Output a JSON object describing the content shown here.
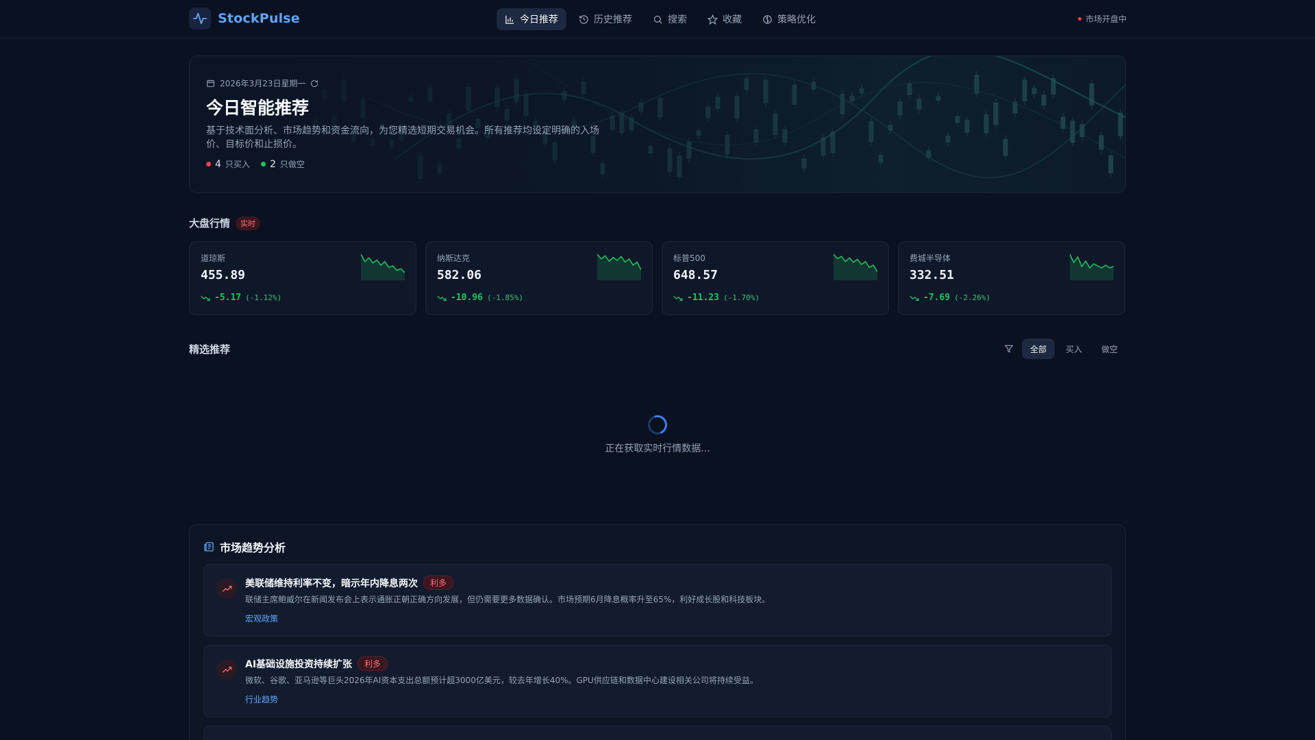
{
  "app": {
    "name": "StockPulse"
  },
  "nav": {
    "items": [
      {
        "label": "今日推荐",
        "icon": "bar-chart-icon",
        "active": true
      },
      {
        "label": "历史推荐",
        "icon": "history-icon",
        "active": false
      },
      {
        "label": "搜索",
        "icon": "search-icon",
        "active": false
      },
      {
        "label": "收藏",
        "icon": "star-icon",
        "active": false
      },
      {
        "label": "策略优化",
        "icon": "brain-icon",
        "active": false
      }
    ],
    "market_status": "市场开盘中"
  },
  "hero": {
    "date": "2026年3月23日星期一",
    "title": "今日智能推荐",
    "description": "基于技术面分析、市场趋势和资金流向，为您精选短期交易机会。所有推荐均设定明确的入场价、目标价和止损价。",
    "buy_count": "4",
    "buy_label": "只买入",
    "short_count": "2",
    "short_label": "只做空"
  },
  "indices": {
    "title": "大盘行情",
    "badge": "实时",
    "cards": [
      {
        "name": "道琼斯",
        "value": "455.89",
        "change": "-5.17",
        "pct": "(-1.12%)",
        "trend": [
          30,
          20,
          25,
          18,
          22,
          15,
          20,
          12,
          14,
          8,
          10,
          5
        ]
      },
      {
        "name": "纳斯达克",
        "value": "582.06",
        "change": "-10.96",
        "pct": "(-1.85%)",
        "trend": [
          28,
          22,
          26,
          19,
          24,
          20,
          25,
          18,
          22,
          14,
          18,
          8
        ]
      },
      {
        "name": "标普500",
        "value": "648.57",
        "change": "-11.23",
        "pct": "(-1.70%)",
        "trend": [
          30,
          24,
          27,
          20,
          25,
          19,
          23,
          16,
          20,
          12,
          15,
          6
        ]
      },
      {
        "name": "费城半导体",
        "value": "332.51",
        "change": "-7.69",
        "pct": "(-2.26%)",
        "trend": [
          32,
          20,
          28,
          14,
          22,
          12,
          18,
          15,
          12,
          16,
          12,
          14
        ]
      }
    ]
  },
  "picks": {
    "title": "精选推荐",
    "filters": [
      "全部",
      "买入",
      "做空"
    ],
    "active_filter": "全部",
    "loading_text": "正在获取实时行情数据..."
  },
  "analysis": {
    "title": "市场趋势分析",
    "items": [
      {
        "title": "美联储维持利率不变，暗示年内降息两次",
        "tag": "利多",
        "body": "联储主席鲍威尔在新闻发布会上表示通胀正朝正确方向发展，但仍需要更多数据确认。市场预期6月降息概率升至65%，利好成长股和科技板块。",
        "category": "宏观政策"
      },
      {
        "title": "AI基础设施投资持续扩张",
        "tag": "利多",
        "body": "微软、谷歌、亚马逊等巨头2026年AI资本支出总额预计超3000亿美元，较去年增长40%。GPU供应链和数据中心建设相关公司将持续受益。",
        "category": "行业趋势"
      }
    ]
  },
  "colors": {
    "accent": "#60a5fa",
    "up": "#22c55e",
    "bull_tag": "#f87171",
    "background": "#0a1120"
  }
}
